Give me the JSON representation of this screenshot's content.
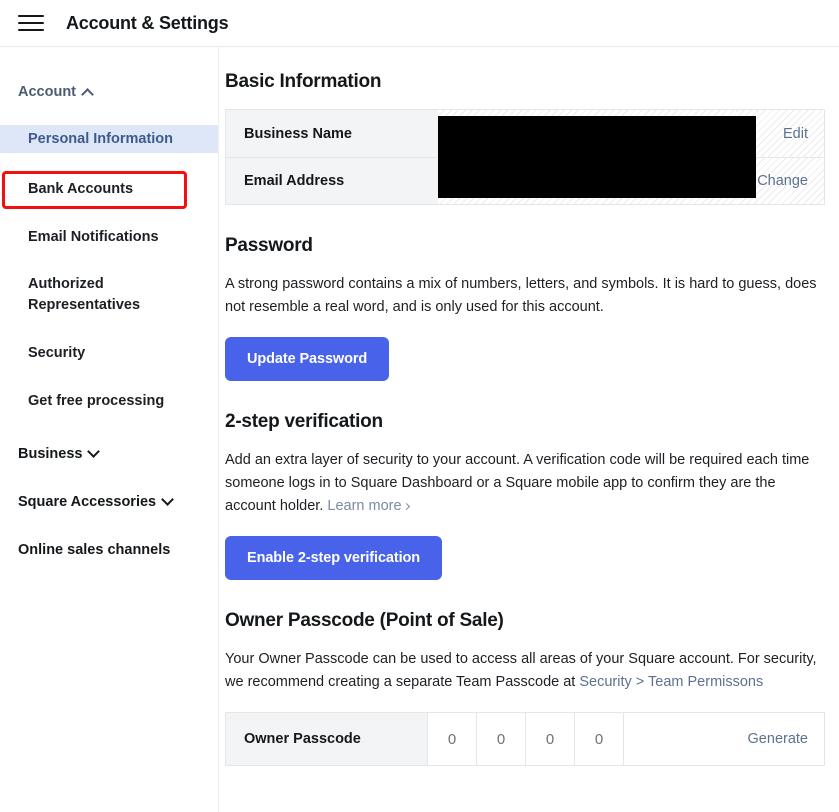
{
  "header": {
    "title": "Account & Settings",
    "menu_icon": "hamburger-menu-icon"
  },
  "sidebar": {
    "groups": [
      {
        "label": "Account",
        "expanded": true,
        "chevron": "chevron-up-icon",
        "items": [
          {
            "label": "Personal Information",
            "selected": true
          },
          {
            "label": "Bank Accounts",
            "selected": false
          },
          {
            "label": "Email Notifications",
            "selected": false
          },
          {
            "label": "Authorized Representatives",
            "selected": false
          },
          {
            "label": "Security",
            "selected": false
          },
          {
            "label": "Get free processing",
            "selected": false
          }
        ]
      },
      {
        "label": "Business",
        "expanded": false,
        "chevron": "chevron-down-icon",
        "items": []
      },
      {
        "label": "Square Accessories",
        "expanded": false,
        "chevron": "chevron-down-icon",
        "items": []
      },
      {
        "label": "Online sales channels",
        "expanded": false,
        "chevron": "none",
        "items": []
      }
    ]
  },
  "annotation": {
    "type": "red-highlight-box",
    "target": "Personal Information",
    "color": "#f10f0f"
  },
  "main": {
    "basic_information": {
      "title": "Basic Information",
      "rows": [
        {
          "label": "Business Name",
          "value": "",
          "redacted": true,
          "action": "Edit"
        },
        {
          "label": "Email Address",
          "value": "",
          "redacted": true,
          "action": "Change"
        }
      ]
    },
    "password": {
      "title": "Password",
      "description": "A strong password contains a mix of numbers, letters, and symbols. It is hard to guess, does not resemble a real word, and is only used for this account.",
      "button": "Update Password"
    },
    "two_step": {
      "title": "2-step verification",
      "description": "Add an extra layer of security to your account. A verification code will be required each time someone logs in to Square Dashboard or a Square mobile app to confirm they are the account holder.",
      "learn_more": "Learn more",
      "button": "Enable 2-step verification"
    },
    "owner_passcode": {
      "title": "Owner Passcode (Point of Sale)",
      "description_before": "Your Owner Passcode can be used to access all areas of your Square account. For security, we recommend creating a separate Team Passcode at ",
      "description_link": "Security > Team Permissons",
      "row_label": "Owner Passcode",
      "digits": [
        "0",
        "0",
        "0",
        "0"
      ],
      "generate_label": "Generate"
    }
  },
  "colors": {
    "primary_button": "#4862ea",
    "selected_nav_bg": "#dde7f7",
    "selected_nav_text": "#3e5b8e",
    "link": "#5d718f",
    "annotation_red": "#f10f0f",
    "table_label_bg": "#f3f4f5"
  }
}
